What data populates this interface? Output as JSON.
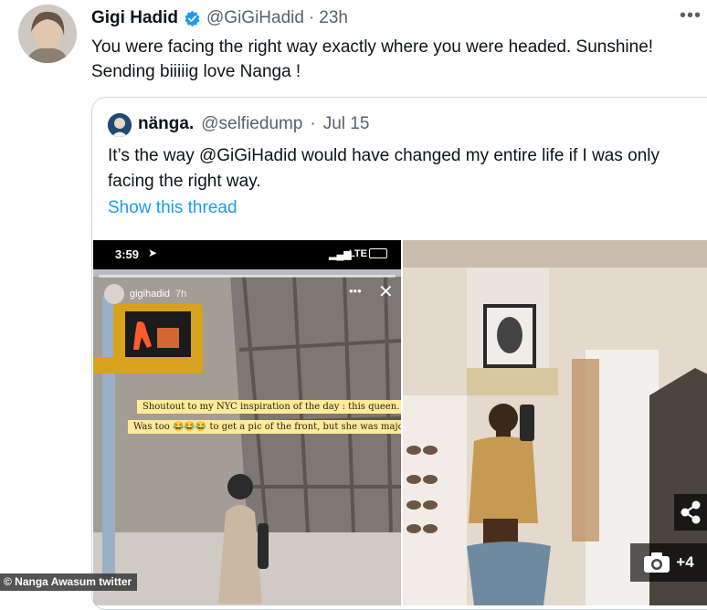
{
  "tweet": {
    "author_name": "Gigi Hadid",
    "author_handle": "@GiGiHadid",
    "separator": "·",
    "time": "23h",
    "text_line1": "You were facing the right way exactly where you were headed. Sunshine!",
    "text_line2": "Sending biiiiig love Nanga !",
    "more_icon": "more-icon",
    "verified_color": "#1d9bf0"
  },
  "quoted": {
    "author_name": "nänga.",
    "author_handle": "@selfiedump",
    "separator": "·",
    "date": "Jul 15",
    "text_line1": "It’s the way @GiGiHadid would have changed my entire life if I was only",
    "text_line2": "facing the right way.",
    "show_thread": "Show this thread"
  },
  "story": {
    "time": "3:59",
    "network": "LTE",
    "user": "gigihadid",
    "age": "7h",
    "caption1": "Shoutout to my NYC inspiration of the day : this queen.",
    "caption2_a": "Was too",
    "caption2_emoji": "😂😂😂",
    "caption2_b": "to get a pic of the front, but she was major."
  },
  "overlay": {
    "credit": "© Nanga Awasum twitter",
    "photo_count": "+4",
    "share_icon": "share-icon",
    "camera_icon": "camera-icon"
  }
}
